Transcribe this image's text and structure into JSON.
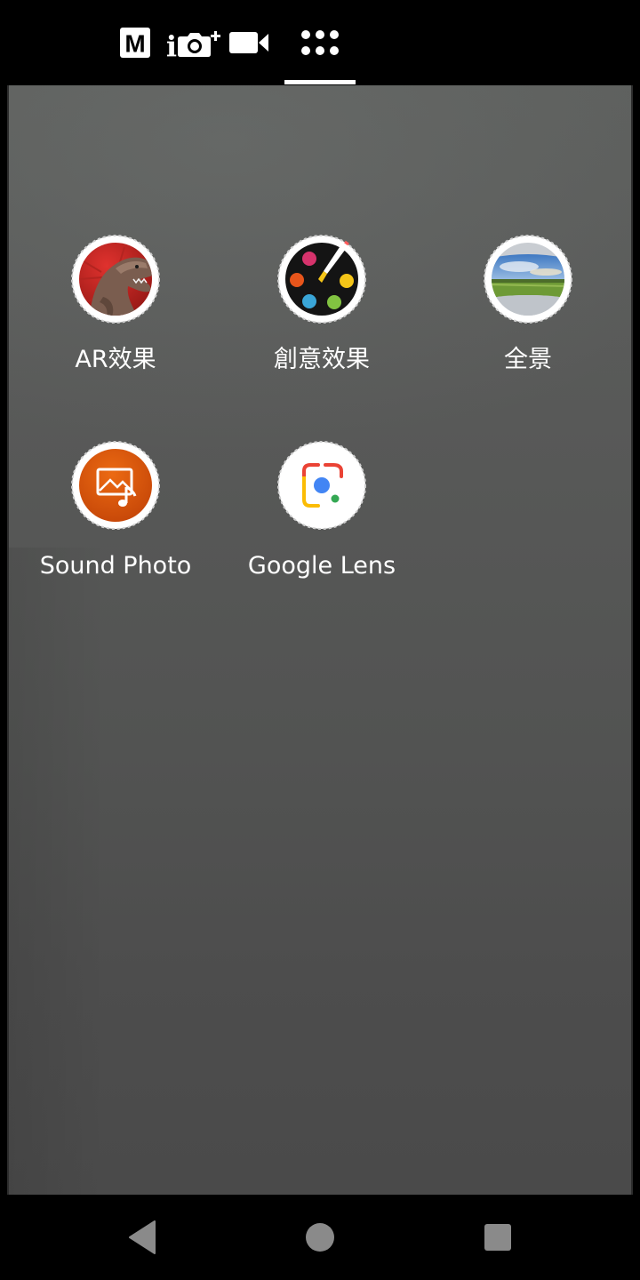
{
  "mode_bar": {
    "modes": [
      {
        "name": "manual",
        "icon": "manual-mode-icon",
        "label": "M"
      },
      {
        "name": "photo",
        "icon": "camera-plus-icon",
        "label": "i"
      },
      {
        "name": "video",
        "icon": "video-camera-icon"
      },
      {
        "name": "more",
        "icon": "grid-dots-icon",
        "active": true
      }
    ]
  },
  "apps": [
    {
      "label": "AR效果",
      "icon": "ar-effect-dinosaur-icon"
    },
    {
      "label": "創意效果",
      "icon": "creative-effect-palette-icon"
    },
    {
      "label": "全景",
      "icon": "panorama-landscape-icon"
    },
    {
      "label": "Sound Photo",
      "icon": "sound-photo-icon"
    },
    {
      "label": "Google Lens",
      "icon": "google-lens-icon"
    }
  ],
  "nav_bar": {
    "buttons": [
      {
        "name": "back",
        "icon": "back-triangle-icon"
      },
      {
        "name": "home",
        "icon": "home-circle-icon"
      },
      {
        "name": "recents",
        "icon": "recents-square-icon"
      }
    ]
  },
  "colors": {
    "accent_white": "#ffffff",
    "sound_photo_orange": "#d9530a",
    "lens_blue": "#4285f4",
    "lens_red": "#ea4335",
    "lens_yellow": "#fbbc04",
    "lens_green": "#34a853"
  }
}
